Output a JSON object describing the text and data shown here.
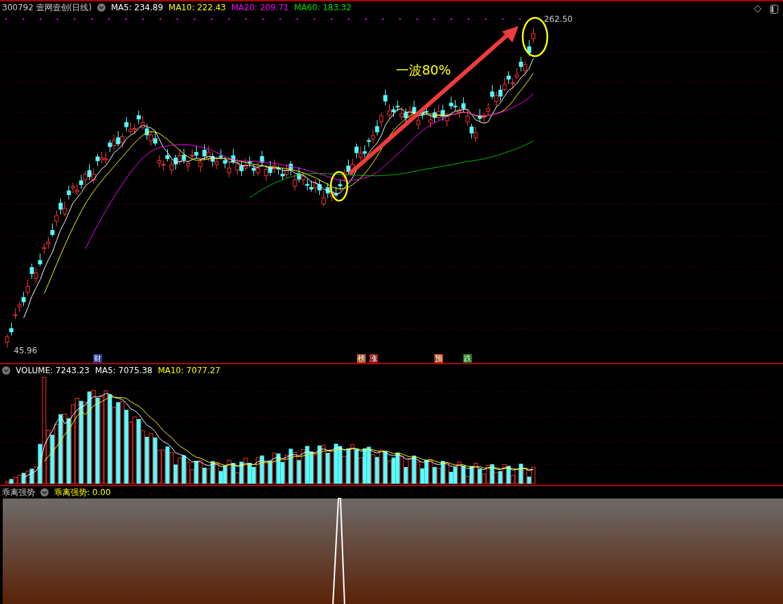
{
  "main_panel": {
    "title": "300792 壹网壹创(日线)",
    "indicators": [
      {
        "label": "MA5: 234.89",
        "color": "#ffffff"
      },
      {
        "label": "MA10: 222.43",
        "color": "#ffff00"
      },
      {
        "label": "MA20: 209.71",
        "color": "#ff00ff"
      },
      {
        "label": "MA60: 183.32",
        "color": "#00e000"
      }
    ],
    "high_label": "262.50",
    "low_label": "45.96",
    "annotation": "一波80%",
    "event_markers": [
      {
        "text": "财",
        "color": "#1a3a8a"
      },
      {
        "text": "榜",
        "color": "#a0501a"
      },
      {
        "text": "涨",
        "color": "#8a1010"
      },
      {
        "text": "预",
        "color": "#b04010"
      },
      {
        "text": "跌",
        "color": "#107a10"
      }
    ]
  },
  "volume_panel": {
    "indicators": [
      {
        "label": "VOLUME: 7243.23",
        "color": "#ffffff"
      },
      {
        "label": "MA5: 7075.38",
        "color": "#ffffff"
      },
      {
        "label": "MA10: 7077.27",
        "color": "#ffff00"
      }
    ]
  },
  "indicator_panel": {
    "title": "乖离强势",
    "indicators": [
      {
        "label": "乖离强势: 0.00",
        "color": "#ffff00"
      }
    ]
  }
}
